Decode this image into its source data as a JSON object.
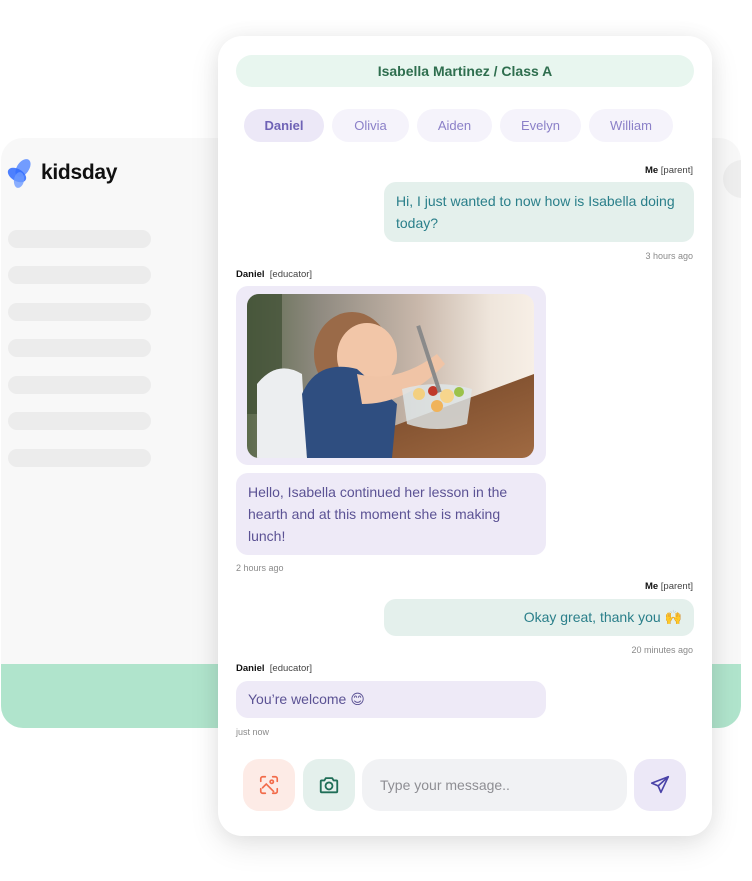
{
  "app": {
    "brand_name": "kidsday",
    "sidebar_placeholder_count": 7
  },
  "chat": {
    "header_title": "Isabella Martinez / Class A",
    "tabs": [
      {
        "label": "Daniel",
        "active": true
      },
      {
        "label": "Olivia",
        "active": false
      },
      {
        "label": "Aiden",
        "active": false
      },
      {
        "label": "Evelyn",
        "active": false
      },
      {
        "label": "William",
        "active": false
      }
    ],
    "messages": [
      {
        "sender": "Me",
        "role": "[parent]",
        "text": "Hi, I just wanted to now how is Isabella doing today?",
        "time": "3 hours ago"
      },
      {
        "sender": "Daniel",
        "role": "[educator]",
        "image": "girl-eating-fruit-salad-photo",
        "text": "Hello, Isabella continued her lesson in the hearth and at this moment she is making lunch!",
        "time": "2 hours ago"
      },
      {
        "sender": "Me",
        "role": "[parent]",
        "text": "Okay great, thank you 🙌",
        "time": "20 minutes ago"
      },
      {
        "sender": "Daniel",
        "role": "[educator]",
        "text": "You’re welcome 😊",
        "time": "just now"
      }
    ],
    "composer": {
      "placeholder": "Type your message..",
      "value": "",
      "scan_icon": "scan-image-icon",
      "camera_icon": "camera-icon",
      "send_icon": "send-icon"
    }
  },
  "colors": {
    "header_bg": "#e8f6ef",
    "header_text": "#2e6e4e",
    "parent_bubble": "#e4f0ec",
    "parent_text": "#2a7f8a",
    "educator_bubble": "#eeeaf7",
    "educator_text": "#5b5294",
    "accent_green": "#b0e4cc",
    "logo_blue": "#2f6bff"
  }
}
